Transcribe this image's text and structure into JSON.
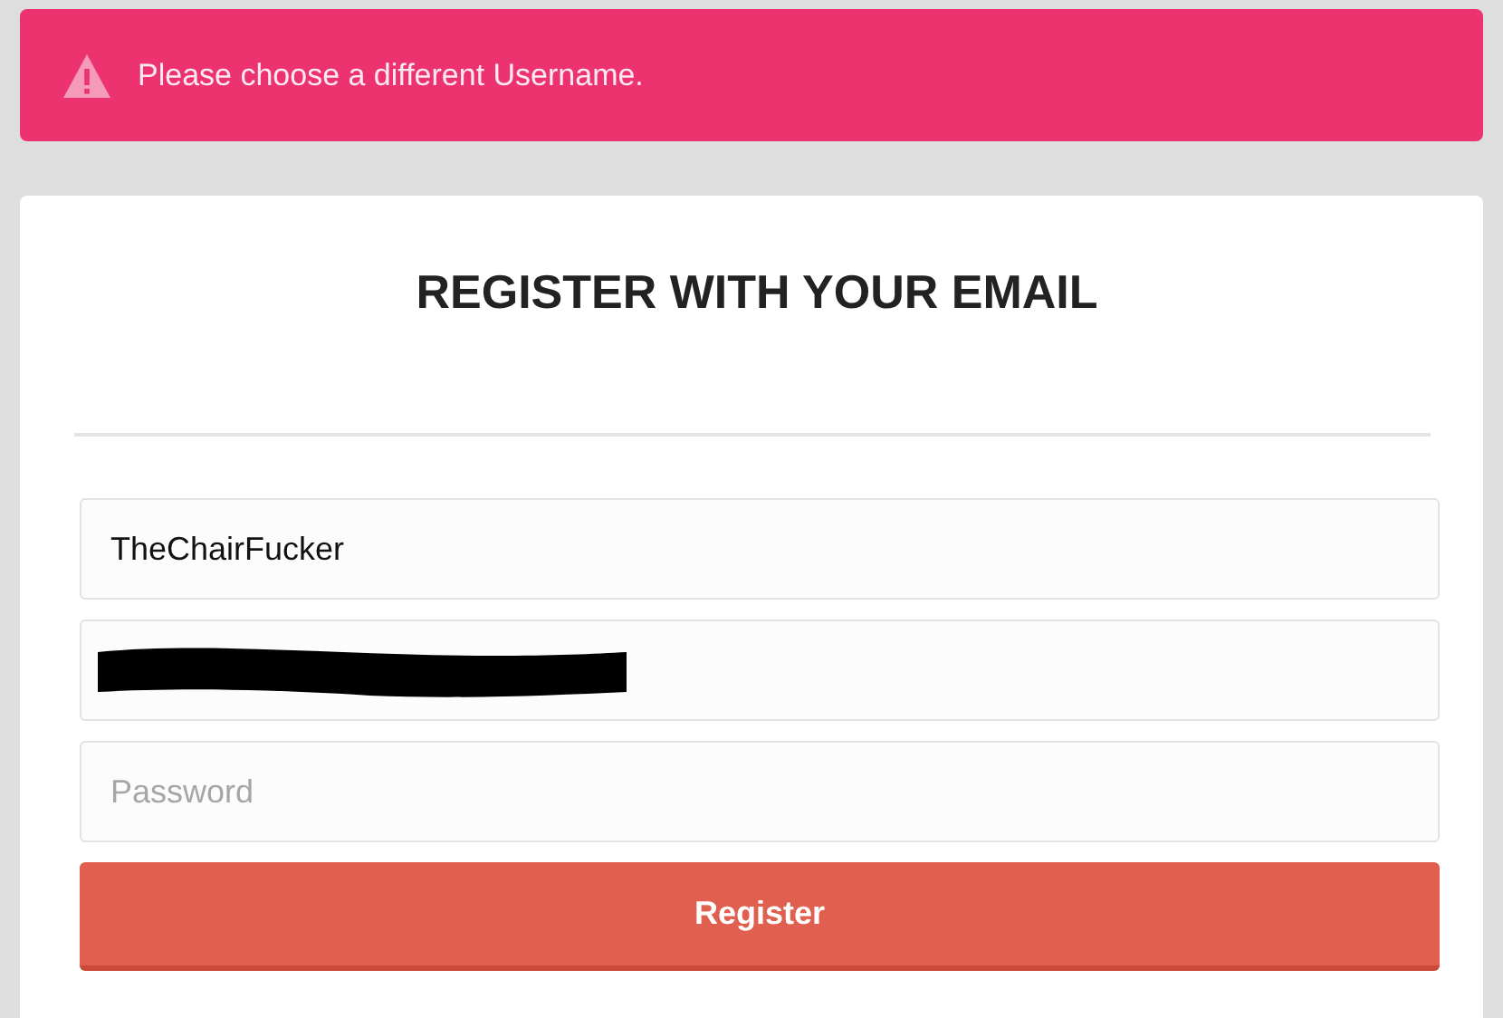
{
  "alert": {
    "message": "Please choose a different Username."
  },
  "form": {
    "title": "REGISTER WITH YOUR EMAIL",
    "fields": [
      {
        "kind": "text",
        "value": "TheChairFucker",
        "redacted": false
      },
      {
        "kind": "text",
        "redacted": true
      },
      {
        "kind": "password",
        "placeholder": "Password",
        "redacted": false
      }
    ],
    "submit": "Register"
  }
}
